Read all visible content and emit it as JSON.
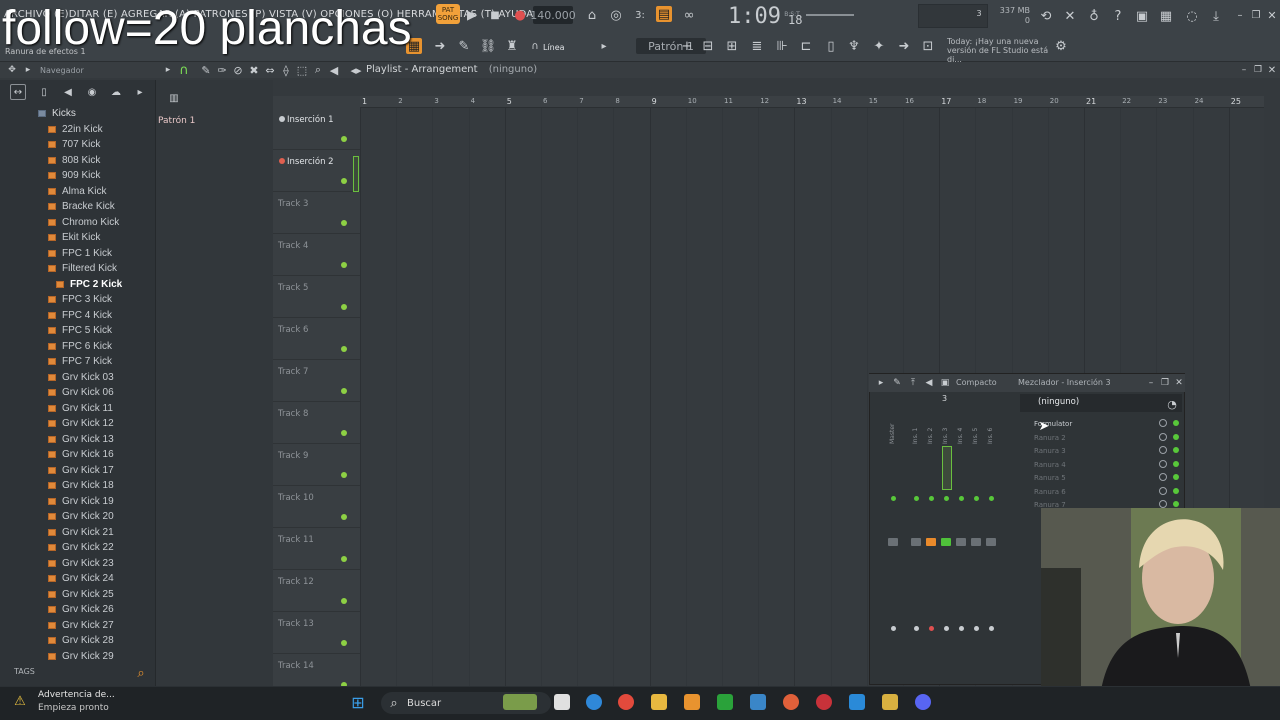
{
  "overlay": {
    "text": "follow=20 planchas"
  },
  "menu": {
    "line": "ARCHIVO (E)DITAR (E) AGREGAR (A) PATRONES (P) VISTA (V) OPCIONES (O) HERRAMIENTAS (T) AYUDA",
    "hint": "Ranura de efectos 1"
  },
  "transport": {
    "pat_label": "PAT",
    "song_label": "SONG",
    "bpm": "140.000",
    "time": "1:09",
    "time_frac": "18",
    "time_unit": "B:S:T",
    "cpu_value": "3",
    "memory": "337 MB",
    "voices": "0"
  },
  "toolbar": {
    "snap_label": "Línea",
    "pattern_selector": "Patrón 1",
    "news": "Today: ¡Hay una nueva versión de FL Studio está di..."
  },
  "browser": {
    "title": "Navegador",
    "items": [
      {
        "label": "Kicks",
        "kind": "folder"
      },
      {
        "label": "22in Kick",
        "kind": "file"
      },
      {
        "label": "707 Kick",
        "kind": "file"
      },
      {
        "label": "808 Kick",
        "kind": "file"
      },
      {
        "label": "909 Kick",
        "kind": "file"
      },
      {
        "label": "Alma Kick",
        "kind": "file"
      },
      {
        "label": "Bracke Kick",
        "kind": "file"
      },
      {
        "label": "Chromo Kick",
        "kind": "file"
      },
      {
        "label": "Ekit Kick",
        "kind": "file"
      },
      {
        "label": "FPC 1 Kick",
        "kind": "file"
      },
      {
        "label": "Filtered Kick",
        "kind": "file"
      },
      {
        "label": "FPC 2 Kick",
        "kind": "selected"
      },
      {
        "label": "FPC 3 Kick",
        "kind": "file"
      },
      {
        "label": "FPC 4 Kick",
        "kind": "file"
      },
      {
        "label": "FPC 5 Kick",
        "kind": "file"
      },
      {
        "label": "FPC 6 Kick",
        "kind": "file"
      },
      {
        "label": "FPC 7 Kick",
        "kind": "file"
      },
      {
        "label": "Grv Kick 03",
        "kind": "file"
      },
      {
        "label": "Grv Kick 06",
        "kind": "file"
      },
      {
        "label": "Grv Kick 11",
        "kind": "file"
      },
      {
        "label": "Grv Kick 12",
        "kind": "file"
      },
      {
        "label": "Grv Kick 13",
        "kind": "file"
      },
      {
        "label": "Grv Kick 16",
        "kind": "file"
      },
      {
        "label": "Grv Kick 17",
        "kind": "file"
      },
      {
        "label": "Grv Kick 18",
        "kind": "file"
      },
      {
        "label": "Grv Kick 19",
        "kind": "file"
      },
      {
        "label": "Grv Kick 20",
        "kind": "file"
      },
      {
        "label": "Grv Kick 21",
        "kind": "file"
      },
      {
        "label": "Grv Kick 22",
        "kind": "file"
      },
      {
        "label": "Grv Kick 23",
        "kind": "file"
      },
      {
        "label": "Grv Kick 24",
        "kind": "file"
      },
      {
        "label": "Grv Kick 25",
        "kind": "file"
      },
      {
        "label": "Grv Kick 26",
        "kind": "file"
      },
      {
        "label": "Grv Kick 27",
        "kind": "file"
      },
      {
        "label": "Grv Kick 28",
        "kind": "file"
      },
      {
        "label": "Grv Kick 29",
        "kind": "file"
      }
    ],
    "tags_label": "TAGS"
  },
  "patterns": {
    "items": [
      "Patrón 1"
    ]
  },
  "playlist": {
    "title": "Playlist - Arrangement",
    "subtitle": "(ninguno)",
    "ruler": [
      "1",
      "2",
      "3",
      "4",
      "5",
      "6",
      "7",
      "8",
      "9",
      "10",
      "11",
      "12",
      "13",
      "14",
      "15",
      "16",
      "17",
      "18",
      "19",
      "20",
      "21",
      "22",
      "23",
      "24",
      "25"
    ],
    "tracks": [
      {
        "name": "Inserción 1",
        "active": true
      },
      {
        "name": "Inserción 2",
        "active": true
      },
      {
        "name": "Track 3",
        "active": false
      },
      {
        "name": "Track 4",
        "active": false
      },
      {
        "name": "Track 5",
        "active": false
      },
      {
        "name": "Track 6",
        "active": false
      },
      {
        "name": "Track 7",
        "active": false
      },
      {
        "name": "Track 8",
        "active": false
      },
      {
        "name": "Track 9",
        "active": false
      },
      {
        "name": "Track 10",
        "active": false
      },
      {
        "name": "Track 11",
        "active": false
      },
      {
        "name": "Track 12",
        "active": false
      },
      {
        "name": "Track 13",
        "active": false
      },
      {
        "name": "Track 14",
        "active": false
      }
    ]
  },
  "mixer": {
    "view_label": "Compacto",
    "title": "Mezclador - Inserción 3",
    "selected_insert": "3",
    "channels": [
      "Master",
      "Ins. 1",
      "Ins. 2",
      "Ins. 3",
      "Ins. 4",
      "Ins. 5",
      "Ins. 6"
    ],
    "preset": "(ninguno)",
    "slots": [
      "Formulator",
      "Ranura 2",
      "Ranura 3",
      "Ranura 4",
      "Ranura 5",
      "Ranura 6",
      "Ranura 7"
    ]
  },
  "taskbar": {
    "notif_title": "Advertencia de...",
    "notif_sub": "Empieza pronto",
    "search": "Buscar"
  }
}
